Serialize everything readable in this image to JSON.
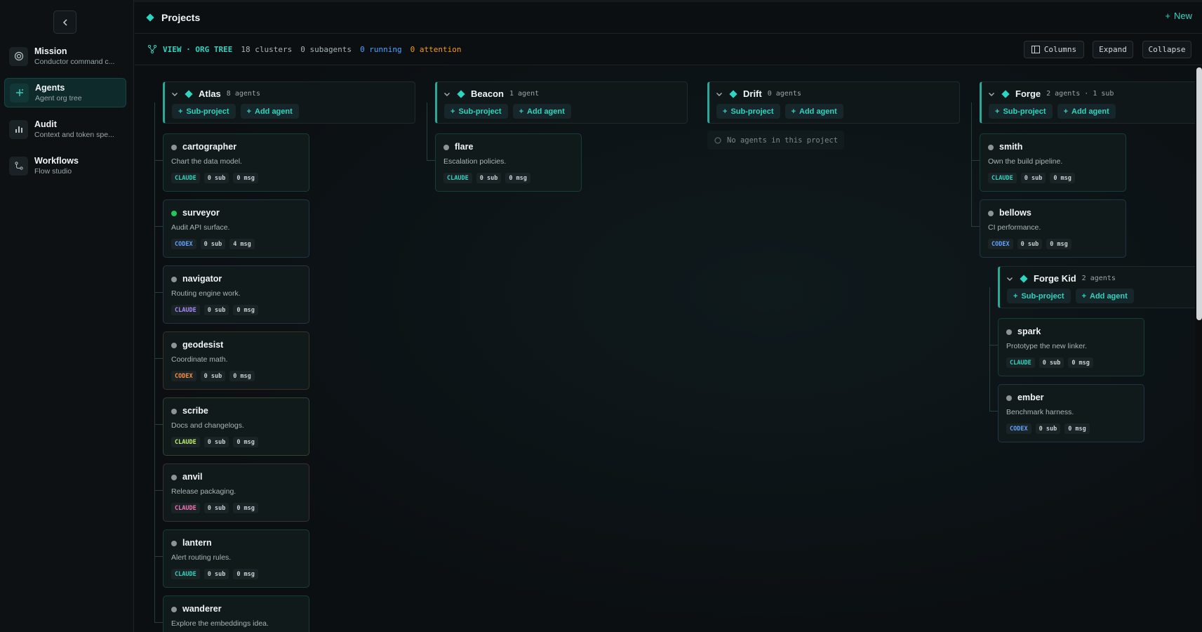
{
  "sidebar": {
    "collapse_icon": "chevron-left-icon",
    "items": [
      {
        "title": "Mission",
        "subtitle": "Conductor command c...",
        "icon": "target-icon"
      },
      {
        "title": "Agents",
        "subtitle": "Agent org tree",
        "icon": "sparkle-icon",
        "active": true
      },
      {
        "title": "Audit",
        "subtitle": "Context and token spe...",
        "icon": "bar-chart-icon"
      },
      {
        "title": "Workflows",
        "subtitle": "Flow studio",
        "icon": "workflow-icon"
      }
    ]
  },
  "header": {
    "title": "Projects",
    "new_label": "New"
  },
  "viewbar": {
    "view_label": "VIEW · ORG TREE",
    "clusters": "18 clusters",
    "subagents": "0 subagents",
    "running": "0 running",
    "attention": "0 attention",
    "columns_label": "Columns",
    "expand_label": "Expand",
    "collapse_label": "Collapse"
  },
  "accent_color": "#2dd4bf",
  "actions": {
    "sub_project": "Sub-project",
    "add_agent": "Add agent"
  },
  "clusters": [
    {
      "name": "Atlas",
      "count": "8 agents",
      "agents": [
        {
          "name": "cartographer",
          "desc": "Chart the data model.",
          "model": "CLAUDE",
          "sub": "0 sub",
          "msg": "0 msg",
          "status_color": "#8c9497",
          "model_color": "#2dd4bf"
        },
        {
          "name": "surveyor",
          "desc": "Audit API surface.",
          "model": "CODEX",
          "sub": "0 sub",
          "msg": "4 msg",
          "status_color": "#22c55e",
          "model_color": "#60a5fa"
        },
        {
          "name": "navigator",
          "desc": "Routing engine work.",
          "model": "CLAUDE",
          "sub": "0 sub",
          "msg": "0 msg",
          "status_color": "#8c9497",
          "model_color": "#a78bfa"
        },
        {
          "name": "geodesist",
          "desc": "Coordinate math.",
          "model": "CODEX",
          "sub": "0 sub",
          "msg": "0 msg",
          "status_color": "#8c9497",
          "model_color": "#fb923c"
        },
        {
          "name": "scribe",
          "desc": "Docs and changelogs.",
          "model": "CLAUDE",
          "sub": "0 sub",
          "msg": "0 msg",
          "status_color": "#8c9497",
          "model_color": "#bef264"
        },
        {
          "name": "anvil",
          "desc": "Release packaging.",
          "model": "CLAUDE",
          "sub": "0 sub",
          "msg": "0 msg",
          "status_color": "#8c9497",
          "model_color": "#f472b6"
        },
        {
          "name": "lantern",
          "desc": "Alert routing rules.",
          "model": "CLAUDE",
          "sub": "0 sub",
          "msg": "0 msg",
          "status_color": "#8c9497",
          "model_color": "#2dd4bf"
        },
        {
          "name": "wanderer",
          "desc": "Explore the embeddings idea.",
          "model": "",
          "sub": "",
          "msg": "",
          "status_color": "#8c9497",
          "model_color": "#2dd4bf"
        }
      ]
    },
    {
      "name": "Beacon",
      "count": "1 agent",
      "agents": [
        {
          "name": "flare",
          "desc": "Escalation policies.",
          "model": "CLAUDE",
          "sub": "0 sub",
          "msg": "0 msg",
          "status_color": "#8c9497",
          "model_color": "#2dd4bf"
        }
      ]
    },
    {
      "name": "Drift",
      "count": "0 agents",
      "empty_text": "No agents in this project",
      "agents": []
    },
    {
      "name": "Forge",
      "count": "2 agents · 1 sub",
      "agents": [
        {
          "name": "smith",
          "desc": "Own the build pipeline.",
          "model": "CLAUDE",
          "sub": "0 sub",
          "msg": "0 msg",
          "status_color": "#8c9497",
          "model_color": "#2dd4bf"
        },
        {
          "name": "bellows",
          "desc": "CI performance.",
          "model": "CODEX",
          "sub": "0 sub",
          "msg": "0 msg",
          "status_color": "#8c9497",
          "model_color": "#60a5fa"
        }
      ]
    },
    {
      "name": "Forge Kid",
      "count": "2 agents",
      "agents": [
        {
          "name": "spark",
          "desc": "Prototype the new linker.",
          "model": "CLAUDE",
          "sub": "0 sub",
          "msg": "0 msg",
          "status_color": "#8c9497",
          "model_color": "#2dd4bf"
        },
        {
          "name": "ember",
          "desc": "Benchmark harness.",
          "model": "CODEX",
          "sub": "0 sub",
          "msg": "0 msg",
          "status_color": "#8c9497",
          "model_color": "#60a5fa"
        }
      ]
    }
  ]
}
